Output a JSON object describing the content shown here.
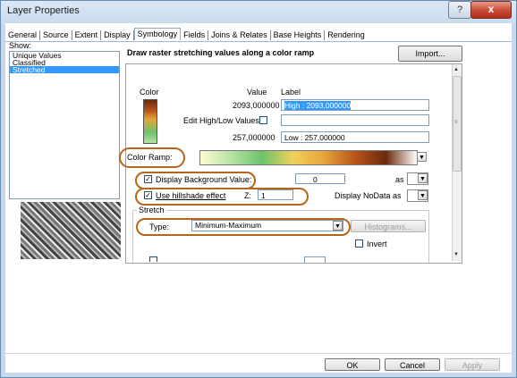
{
  "window": {
    "title": "Layer Properties",
    "help_label": "?",
    "close_label": "x"
  },
  "tabs": [
    "General",
    "Source",
    "Extent",
    "Display",
    "Symbology",
    "Fields",
    "Joins & Relates",
    "Base Heights",
    "Rendering"
  ],
  "active_tab": "Symbology",
  "show": {
    "label": "Show:",
    "items": [
      "Unique Values",
      "Classified",
      "Stretched"
    ],
    "selected": "Stretched"
  },
  "description": "Draw raster stretching values along a color ramp",
  "import_label": "Import...",
  "legend": {
    "color_header": "Color",
    "value_header": "Value",
    "label_header": "Label",
    "high_value": "2093,000000",
    "high_label": "High : 2093,000000",
    "edit_label": "Edit High/Low Values",
    "low_value": "257,000000",
    "low_label": "Low : 257,000000"
  },
  "color_ramp": {
    "label": "Color Ramp:",
    "colors": [
      "#fffcd4",
      "#b7e3a4",
      "#6cc26b",
      "#f1d15b",
      "#e6a53a",
      "#b8541b",
      "#6b2a0d",
      "#ffffff"
    ]
  },
  "background": {
    "label": "Display Background Value:",
    "checked": true,
    "value": "0",
    "as_label": "as"
  },
  "hillshade": {
    "label": "Use hillshade effect",
    "checked": true,
    "z_label": "Z:",
    "z_value": "1",
    "nodata_label": "Display NoData as"
  },
  "stretch": {
    "group_label": "Stretch",
    "type_label": "Type:",
    "type_value": "Minimum-Maximum",
    "histograms_label": "Histograms...",
    "invert_label": "Invert"
  },
  "buttons": {
    "ok": "OK",
    "cancel": "Cancel",
    "apply": "Apply"
  },
  "colors": {
    "highlight": "#b7651a",
    "selection": "#3399ff",
    "titlebar": "#c6d8ee"
  }
}
